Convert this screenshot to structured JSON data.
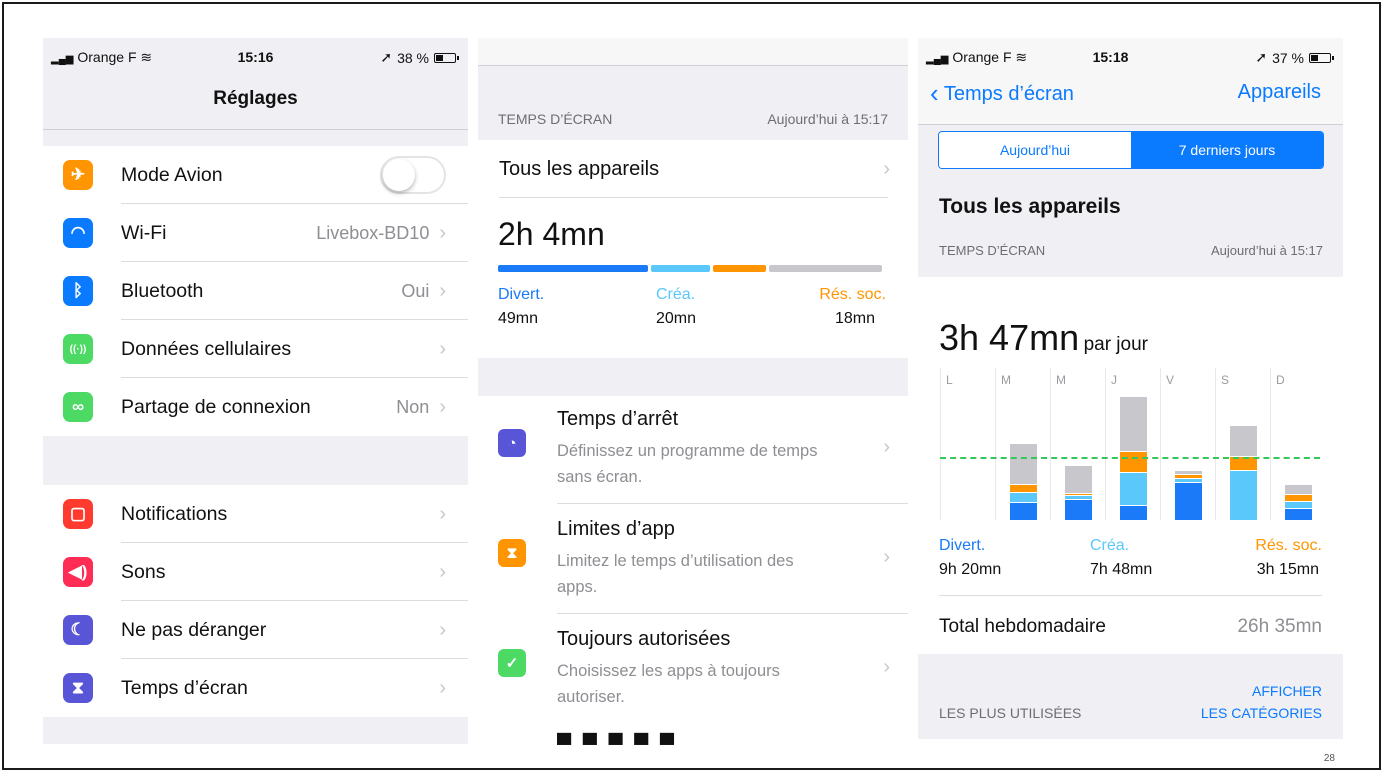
{
  "page_number": "28",
  "colors": {
    "divert": "#1a7af8",
    "crea": "#5ac8fa",
    "res_soc": "#ff9500",
    "other": "#c7c7cc",
    "ios_blue": "#0a7aff",
    "avg_line": "#34c759"
  },
  "screen1": {
    "status": {
      "carrier": "Orange F",
      "time": "15:16",
      "battery": "38 %"
    },
    "title": "Réglages",
    "group1": [
      {
        "icon": "airplane-icon",
        "color": "#ff9500",
        "glyph": "✈",
        "label": "Mode Avion",
        "value": "",
        "control": "toggle"
      },
      {
        "icon": "wifi-icon",
        "color": "#0a7aff",
        "glyph": "◠",
        "label": "Wi-Fi",
        "value": "Livebox-BD10"
      },
      {
        "icon": "bluetooth-icon",
        "color": "#0a7aff",
        "glyph": "ᛒ",
        "label": "Bluetooth",
        "value": "Oui"
      },
      {
        "icon": "cellular-antenna-icon",
        "color": "#4cd964",
        "glyph": "((·))",
        "label": "Données cellulaires",
        "value": ""
      },
      {
        "icon": "hotspot-link-icon",
        "color": "#4cd964",
        "glyph": "∞",
        "label": "Partage de connexion",
        "value": "Non"
      }
    ],
    "group2": [
      {
        "icon": "notifications-icon",
        "color": "#ff3b30",
        "glyph": "▢",
        "label": "Notifications"
      },
      {
        "icon": "speaker-icon",
        "color": "#ff2d55",
        "glyph": "◀)",
        "label": "Sons"
      },
      {
        "icon": "moon-icon",
        "color": "#5856d6",
        "glyph": "☾",
        "label": "Ne pas déranger"
      },
      {
        "icon": "hourglass-icon",
        "color": "#5856d6",
        "glyph": "⧗",
        "label": "Temps d’écran"
      }
    ]
  },
  "screen2": {
    "section_label": "TEMPS D’ÉCRAN",
    "section_time": "Aujourd’hui à 15:17",
    "devices": "Tous les appareils",
    "total": "2h 4mn",
    "usage_fractions": {
      "divert": 0.395,
      "crea": 0.161,
      "res_soc": 0.145,
      "other": 0.299
    },
    "categories": [
      {
        "name": "Divert.",
        "value": "49mn"
      },
      {
        "name": "Créa.",
        "value": "20mn"
      },
      {
        "name": "Rés. soc.",
        "value": "18mn"
      }
    ],
    "items": [
      {
        "icon": "downtime-icon",
        "color": "#5856d6",
        "glyph": "◔",
        "title": "Temps d’arrêt",
        "desc": "Définissez un programme de temps sans écran."
      },
      {
        "icon": "hourglass-icon",
        "color": "#ff9500",
        "glyph": "⧗",
        "title": "Limites d’app",
        "desc": "Limitez le temps d’utilisation des apps."
      },
      {
        "icon": "checkmark-badge-icon",
        "color": "#4cd964",
        "glyph": "✓",
        "title": "Toujours autorisées",
        "desc": "Choisissez les apps à toujours autoriser."
      }
    ]
  },
  "screen3": {
    "status": {
      "carrier": "Orange F",
      "time": "15:18",
      "battery": "37 %"
    },
    "nav_back": "Temps d’écran",
    "nav_right": "Appareils",
    "segment": [
      "Aujourd’hui",
      "7 derniers jours"
    ],
    "devices": "Tous les appareils",
    "section_label": "TEMPS D’ÉCRAN",
    "section_time": "Aujourd’hui à 15:17",
    "avg_value": "3h 47mn",
    "avg_unit": "par jour",
    "categories": [
      {
        "name": "Divert.",
        "value": "9h 20mn"
      },
      {
        "name": "Créa.",
        "value": "7h 48mn"
      },
      {
        "name": "Rés. soc.",
        "value": "3h 15mn"
      }
    ],
    "total_label": "Total hebdomadaire",
    "total_value": "26h 35mn",
    "most_used": "LES PLUS UTILISÉES",
    "show_categories": [
      "AFFICHER",
      "LES CATÉGORIES"
    ]
  },
  "chart_data": {
    "type": "bar",
    "stacked": true,
    "categories": [
      "L",
      "M",
      "M",
      "J",
      "V",
      "S",
      "D"
    ],
    "series": [
      {
        "name": "Divert.",
        "values": [
          0,
          0.6,
          0.7,
          0.5,
          1.3,
          0.0,
          0.4
        ]
      },
      {
        "name": "Créa.",
        "values": [
          0,
          0.3,
          0.1,
          1.1,
          0.1,
          1.7,
          0.2
        ]
      },
      {
        "name": "Rés. soc.",
        "values": [
          0,
          0.25,
          0.05,
          0.7,
          0.1,
          0.45,
          0.2
        ]
      },
      {
        "name": "",
        "values": [
          0,
          1.4,
          0.95,
          1.9,
          0.1,
          1.05,
          0.3
        ]
      }
    ],
    "average_line": 2.2,
    "ylim": [
      0,
      5.3
    ]
  }
}
